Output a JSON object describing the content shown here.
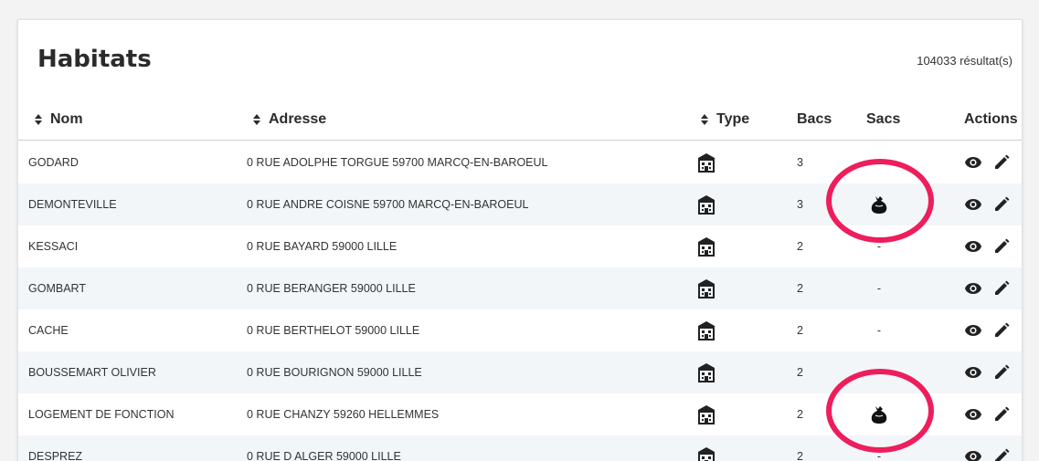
{
  "page": {
    "title": "Habitats",
    "result_count": "104033 résultat(s)"
  },
  "columns": {
    "nom": "Nom",
    "adresse": "Adresse",
    "type": "Type",
    "bacs": "Bacs",
    "sacs": "Sacs",
    "actions": "Actions"
  },
  "rows": [
    {
      "nom": "GODARD",
      "adresse": "0 RUE ADOLPHE TORGUE 59700 MARCQ-EN-BAROEUL",
      "type_icon": "building-icon",
      "bacs": "3",
      "sacs": ""
    },
    {
      "nom": "DEMONTEVILLE",
      "adresse": "0 RUE ANDRE COISNE 59700 MARCQ-EN-BAROEUL",
      "type_icon": "building-icon",
      "bacs": "3",
      "sacs": "bag-icon"
    },
    {
      "nom": "KESSACI",
      "adresse": "0 RUE BAYARD 59000 LILLE",
      "type_icon": "building-icon",
      "bacs": "2",
      "sacs": "-"
    },
    {
      "nom": "GOMBART",
      "adresse": "0 RUE BERANGER 59000 LILLE",
      "type_icon": "building-icon",
      "bacs": "2",
      "sacs": "-"
    },
    {
      "nom": "CACHE",
      "adresse": "0 RUE BERTHELOT 59000 LILLE",
      "type_icon": "building-icon",
      "bacs": "2",
      "sacs": "-"
    },
    {
      "nom": "BOUSSEMART OLIVIER",
      "adresse": "0 RUE BOURIGNON 59000 LILLE",
      "type_icon": "building-icon",
      "bacs": "2",
      "sacs": ""
    },
    {
      "nom": "LOGEMENT DE FONCTION",
      "adresse": "0 RUE CHANZY 59260 HELLEMMES",
      "type_icon": "building-icon",
      "bacs": "2",
      "sacs": "bag-icon"
    },
    {
      "nom": "DESPREZ",
      "adresse": "0 RUE D ALGER 59000 LILLE",
      "type_icon": "building-icon",
      "bacs": "2",
      "sacs": "-"
    }
  ],
  "row_actions": [
    "view-icon",
    "edit-icon"
  ],
  "colors": {
    "annotation": "#ee1d5c",
    "row_alt": "#f2f6f9",
    "text": "#333333"
  }
}
